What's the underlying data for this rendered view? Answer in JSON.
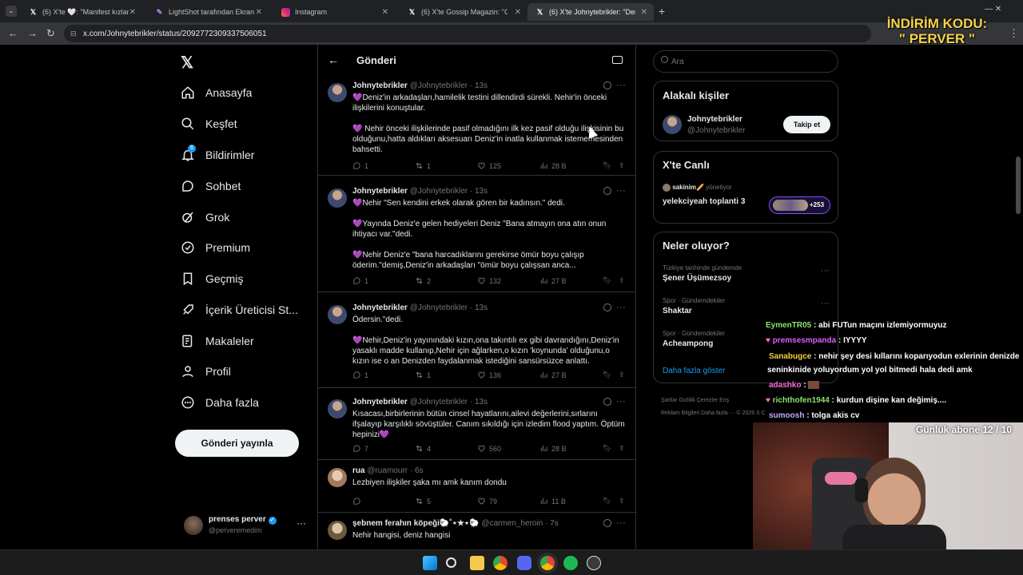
{
  "browser": {
    "tabs": [
      {
        "label": "(6) X'te 🤍: \"Manifest kızlar, fa"
      },
      {
        "label": "LightShot tarafından Ekran Gö"
      },
      {
        "label": "Instagram"
      },
      {
        "label": "(6) X'te Gossip Magazin: \"Gizem"
      },
      {
        "label": "(6) X'te Johnytebrikler: \"Deniz'"
      }
    ],
    "new_tab": "+",
    "url": "x.com/Johnytebrikler/status/2092772309337506051"
  },
  "overlay_promo": {
    "line1": "İNDİRİM KODU:",
    "line2": "\" PERVER \""
  },
  "nav": {
    "items": [
      {
        "label": "Anasayfa"
      },
      {
        "label": "Keşfet"
      },
      {
        "label": "Bildirimler",
        "badge": "6"
      },
      {
        "label": "Sohbet"
      },
      {
        "label": "Grok"
      },
      {
        "label": "Premium"
      },
      {
        "label": "Geçmiş"
      },
      {
        "label": "İçerik Üreticisi St..."
      },
      {
        "label": "Makaleler"
      },
      {
        "label": "Profil"
      },
      {
        "label": "Daha fazla"
      }
    ],
    "post_button": "Gönderi yayınla",
    "profile": {
      "name": "prenses perver",
      "handle": "@perveremedim"
    }
  },
  "header": {
    "title": "Gönderi"
  },
  "tweets": [
    {
      "name": "Johnytebrikler",
      "handle": "@Johnytebrikler · 13s",
      "p1": "💜Deniz'in arkadaşları,hamilelik testini dillendirdi sürekli. Nehir'in önceki ilişkilerini konuştular.",
      "p2": "💜 Nehir önceki ilişkilerinde pasif olmadığını ilk kez pasif olduğu ilişkisinin bu olduğunu,hatta aldıkları aksesuarı Deniz'in inatla kullanmak istememesinden bahsetti.",
      "p3": "",
      "replies": "1",
      "reposts": "1",
      "likes": "125",
      "views": "28 B"
    },
    {
      "name": "Johnytebrikler",
      "handle": "@Johnytebrikler · 13s",
      "p1": "💜Nehir \"Sen kendini erkek olarak gören bir kadınsın.\" dedi.",
      "p2": "💜Yayında Deniz'e gelen hediyeleri Deniz \"Bana atmayın ona atın onun ihtiyacı var.\"dedi.",
      "p3": "💜Nehir Deniz'e \"bana harcadıklarını gerekirse ömür boyu çalışıp öderim.\"demiş,Deniz'in arkadaşları \"ömür boyu çalışsan anca...",
      "replies": "1",
      "reposts": "2",
      "likes": "132",
      "views": "27 B"
    },
    {
      "name": "Johnytebrikler",
      "handle": "@Johnytebrikler · 13s",
      "p1": "Ödersin.\"dedi.",
      "p2": "💜Nehir,Deniz'in yayınındaki kızın,ona takıntılı ex gibi davrandığını,Deniz'in yasaklı madde kullanıp,Nehir için ağlarken,o kızın 'koynunda' olduğunu,o kızın ise o an Denizden faydalanmak istediğini sansürsüzce anlattı.",
      "p3": "",
      "replies": "1",
      "reposts": "1",
      "likes": "136",
      "views": "27 B"
    },
    {
      "name": "Johnytebrikler",
      "handle": "@Johnytebrikler · 13s",
      "p1": "Kısacası,birbirlerinin bütün cinsel hayatlarını,ailevi değerlerini,sırlarını ifşalayıp karşılıklı sövüştüler. Canım sıkıldığı için izledim flood yaptım. Öptüm hepinizi💜",
      "p2": "",
      "p3": "",
      "replies": "7",
      "reposts": "4",
      "likes": "560",
      "views": "28 B"
    },
    {
      "name": "rua",
      "handle": "@ruamourr · 6s",
      "p1": "Lezbiyen ilişkiler şaka mı amk kanım dondu",
      "p2": "",
      "p3": "",
      "replies": "",
      "reposts": "5",
      "likes": "79",
      "views": "11 B"
    },
    {
      "name": "şebnem ferahın köpeği🐑˚⋆★⋆🐑",
      "handle": "@carmen_heroin · 7s",
      "p1": "Nehir hangisi, deniz hangisi",
      "p2": "",
      "p3": "",
      "replies": "",
      "reposts": "",
      "likes": "",
      "views": ""
    }
  ],
  "right": {
    "search_placeholder": "Ara",
    "related": {
      "title": "Alakalı kişiler",
      "name": "Johnytebrikler",
      "handle": "@Johnytebrikler",
      "follow": "Takip et"
    },
    "live": {
      "title": "X'te Canlı",
      "host": "sakinim🥖",
      "host_suffix": "yönetiyor",
      "space": "yelekciyeah toplanti 3",
      "count": "+253"
    },
    "trends": {
      "title": "Neler oluyor?",
      "items": [
        {
          "context": "Türkiye tarihinde gündemde",
          "name": "Şener Üşümezsoy"
        },
        {
          "context": "Spor · Gündemdekiler",
          "name": "Shaktar"
        },
        {
          "context": "Spor · Gündemdekiler",
          "name": "Acheampong"
        }
      ],
      "show_more": "Daha fazla göster"
    },
    "footer": {
      "l1": "Şartlar    Gizlilik    Çerezler    Eriş",
      "l2": "Reklam Bilgileri    Daha fazla ···    © 2026 X Corp."
    }
  },
  "chat": [
    {
      "user": "EymenTR05",
      "msg": ": abi FUTun maçını izlemiyormuyuz",
      "color": "#8fe36b"
    },
    {
      "user": "premsesmpanda",
      "msg": ": IYYYY",
      "color": "#e05bff"
    },
    {
      "user": "Sanabugce",
      "msg": ": nehir şey desi kıllarını koparıyodun exlerinin denizde",
      "color": "#f5d142"
    },
    {
      "user": "",
      "msg": "seninkinide yoluyordum yol yol bitmedi hala dedi amk",
      "color": "#ffffff"
    },
    {
      "user": "adashko",
      "msg": ":",
      "color": "#ff6ad5"
    },
    {
      "user": "richthofen1944",
      "msg": ": kurdun dişine kan değimiş....",
      "color": "#8fe36b"
    },
    {
      "user": "sumoosh",
      "msg": ": tolga akis cv",
      "color": "#c9a6ff"
    }
  ],
  "stream": {
    "sub_goal": "Günlük abone 12 / 10"
  }
}
